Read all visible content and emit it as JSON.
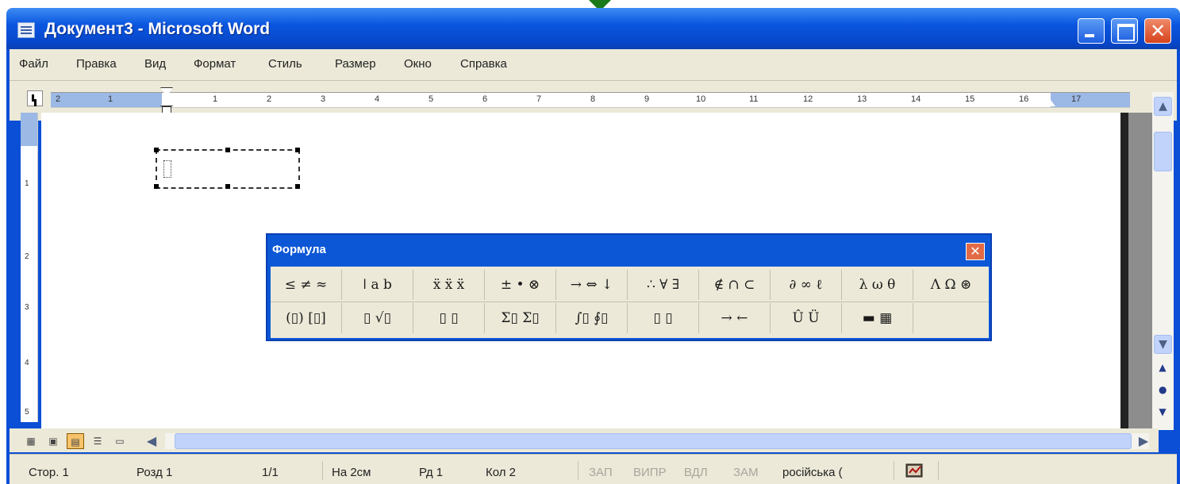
{
  "window": {
    "title": "Документ3 - Microsoft Word",
    "close_glyph": "✕"
  },
  "menu": [
    "Файл",
    "Правка",
    "Вид",
    "Формат",
    "Стиль",
    "Размер",
    "Окно",
    "Справка"
  ],
  "ruler": {
    "numbers": [
      "2",
      "1",
      "1",
      "1",
      "2",
      "3",
      "4",
      "5",
      "6",
      "7",
      "8",
      "9",
      "10",
      "11",
      "12",
      "13",
      "14",
      "15",
      "16",
      "17"
    ]
  },
  "vertical_ruler": {
    "numbers": [
      "1",
      "2",
      "3",
      "4",
      "5"
    ]
  },
  "formula_toolbar": {
    "title": "Формула",
    "close_glyph": "✕",
    "row1": [
      "≤ ≠ ≈",
      "ǀ a b",
      "ẍ ẍ ẍ",
      "± • ⊗",
      "→ ⇔ ↓",
      "∴ ∀ ∃",
      "∉ ∩ ⊂",
      "∂ ∞ ℓ",
      "λ ω θ",
      "Λ Ω ⊛"
    ],
    "row2": [
      "(▯) [▯]",
      "▯ √▯",
      "▯ ▯",
      "Σ▯ Σ▯",
      "∫▯ ∮▯",
      "▯ ▯",
      "→ ←",
      "Û Ü",
      "▬ ▦",
      ""
    ]
  },
  "status": {
    "page": "Стор. 1",
    "section": "Розд 1",
    "pages": "1/1",
    "position": "На 2см",
    "line": "Рд 1",
    "column": "Кол 2",
    "rec": "ЗАП",
    "trk": "ВИПР",
    "ext": "ВДЛ",
    "ovr": "ЗАМ",
    "language": "російська ("
  },
  "colors": {
    "titlebar": "#0b56e0",
    "chrome": "#ece9d8",
    "ruler_margin": "#9cb8e4",
    "close_button": "#d6431b"
  },
  "icons": {
    "title_icon": "word-document-icon",
    "minimize": "minimize-icon",
    "maximize": "maximize-icon",
    "close": "close-icon",
    "status_icon": "spelling-book-icon"
  }
}
